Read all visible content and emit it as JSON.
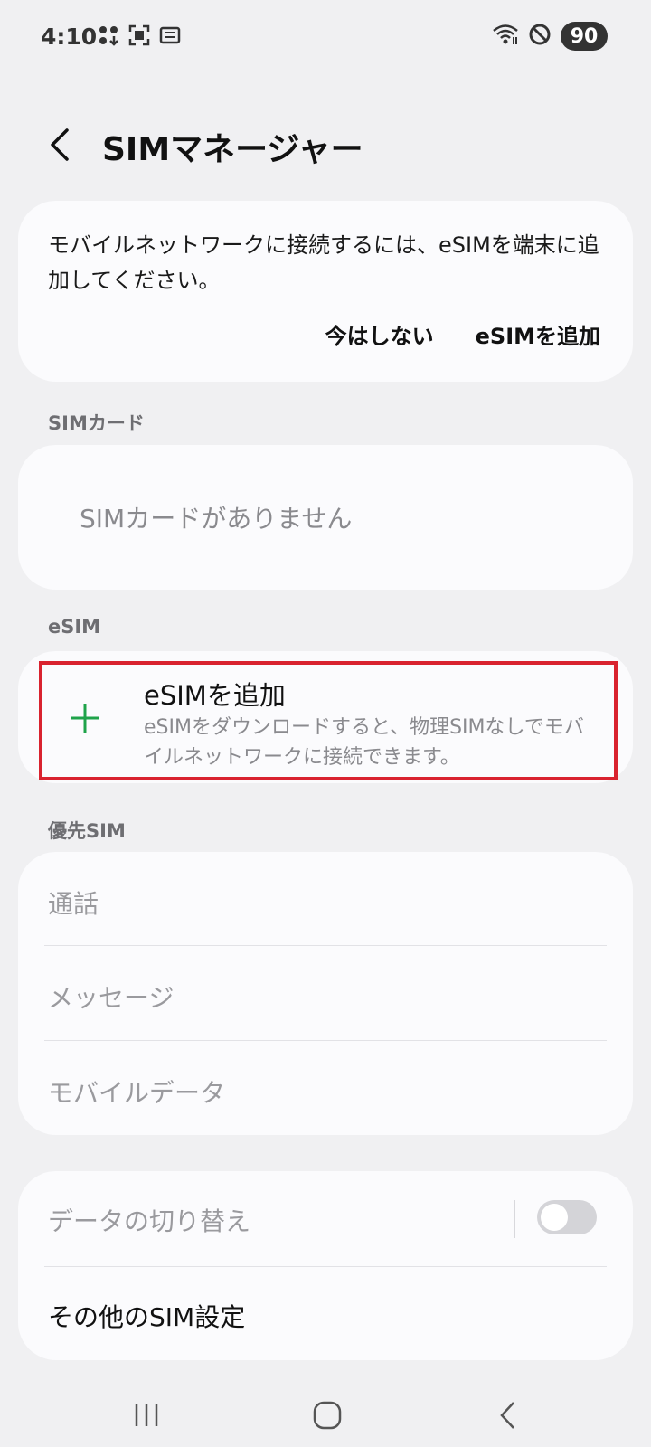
{
  "status_bar": {
    "time": "4:10",
    "battery": "90",
    "icons": [
      "apps-icon",
      "screenshot-icon",
      "media-icon",
      "wifi-icon",
      "do-not-disturb-icon"
    ]
  },
  "header": {
    "title": "SIMマネージャー",
    "back_icon": "back-arrow-icon"
  },
  "notice": {
    "text": "モバイルネットワークに接続するには、eSIMを端末に追加してください。",
    "not_now_label": "今はしない",
    "add_esim_label": "eSIMを追加"
  },
  "sim_card_section": {
    "label": "SIMカード",
    "empty_text": "SIMカードがありません"
  },
  "esim_section": {
    "label": "eSIM",
    "add_title": "eSIMを追加",
    "add_description": "eSIMをダウンロードすると、物理SIMなしでモバイルネットワークに接続できます。",
    "accent_color": "#1fa34a"
  },
  "priority_section": {
    "label": "優先SIM",
    "items": [
      "通話",
      "メッセージ",
      "モバイルデータ"
    ]
  },
  "other": {
    "data_switch_label": "データの切り替え",
    "data_switch_on": false,
    "more_settings_label": "その他のSIM設定"
  },
  "highlight_color": "#d9232f"
}
